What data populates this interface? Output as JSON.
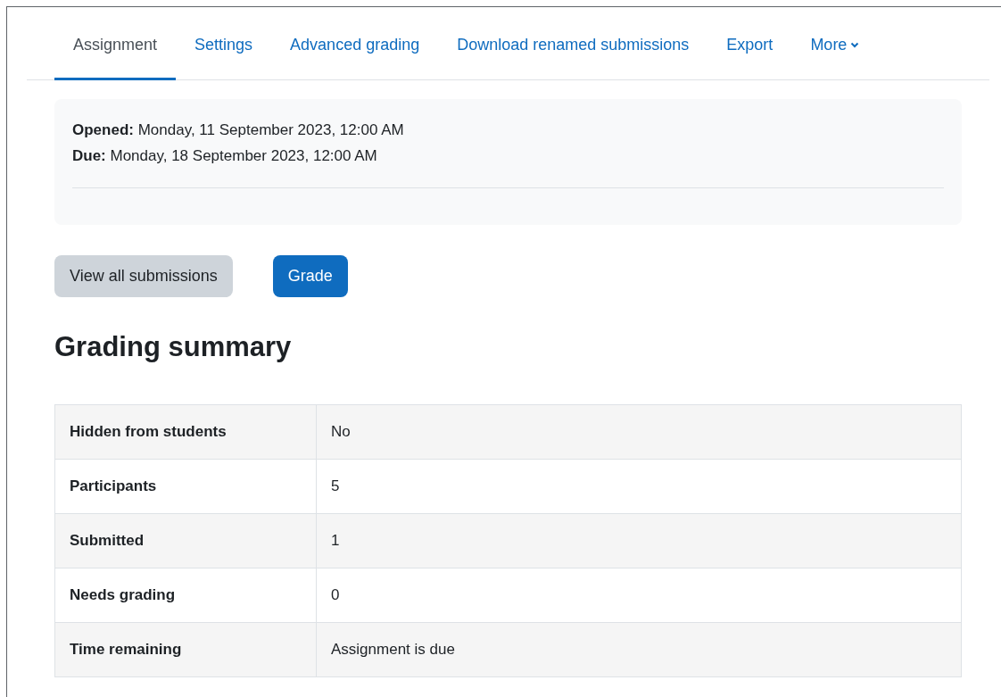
{
  "tabs": [
    {
      "label": "Assignment",
      "selected": true
    },
    {
      "label": "Settings",
      "selected": false
    },
    {
      "label": "Advanced grading",
      "selected": false
    },
    {
      "label": "Download renamed submissions",
      "selected": false
    },
    {
      "label": "Export",
      "selected": false
    },
    {
      "label": "More",
      "selected": false,
      "dropdown": true
    }
  ],
  "dates": [
    {
      "label": "Opened:",
      "value": "Monday, 11 September 2023, 12:00 AM"
    },
    {
      "label": "Due:",
      "value": "Monday, 18 September 2023, 12:00 AM"
    }
  ],
  "buttons": [
    {
      "label": "View all submissions",
      "kind": "secondary"
    },
    {
      "label": "Grade",
      "kind": "primary"
    }
  ],
  "heading": "Grading summary",
  "summary": [
    {
      "label": "Hidden from students",
      "value": "No"
    },
    {
      "label": "Participants",
      "value": "5"
    },
    {
      "label": "Submitted",
      "value": "1"
    },
    {
      "label": "Needs grading",
      "value": "0"
    },
    {
      "label": "Time remaining",
      "value": "Assignment is due"
    }
  ]
}
